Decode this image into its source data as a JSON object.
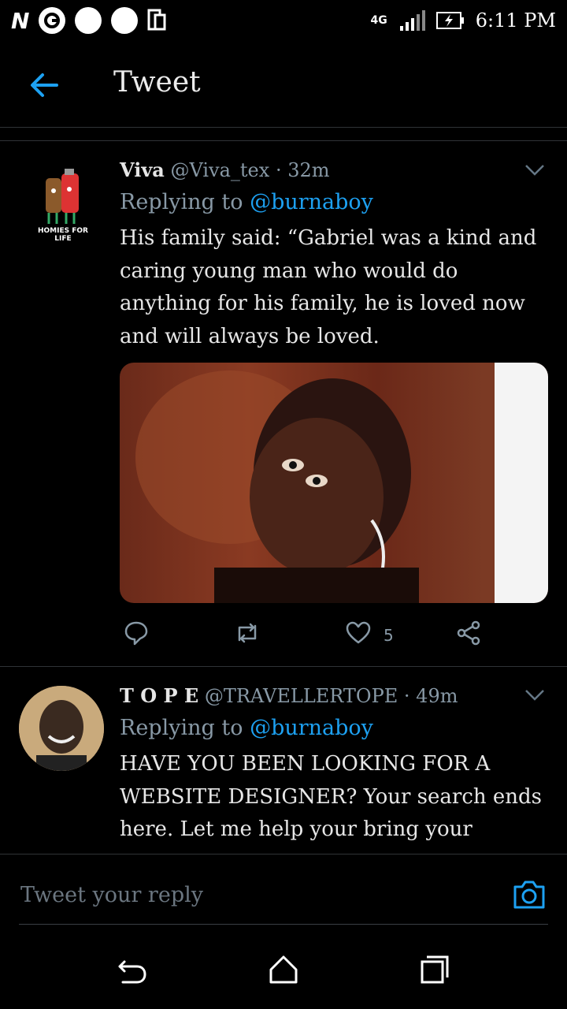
{
  "status_bar": {
    "network": "4G",
    "time": "6:11 PM"
  },
  "header": {
    "title": "Tweet"
  },
  "tweets": [
    {
      "name": "Viva",
      "handle": "@Viva_tex",
      "time": "· 32m",
      "replying_prefix": "Replying to",
      "replying_handle": "@burnaboy",
      "text": "His family said: “Gabriel was a kind and caring young man who would do anything for his family, he is loved now and will always be loved.",
      "likes": "5",
      "avatar_text": "HOMIES FOR LIFE"
    },
    {
      "name": "T O P E",
      "handle": "@TRAVELLERTOPE",
      "time": "· 49m",
      "replying_prefix": "Replying to",
      "replying_handle": "@burnaboy",
      "text": "HAVE YOU BEEN LOOKING FOR A WEBSITE DESIGNER? Your search ends here. Let me help your bring your"
    }
  ],
  "reply_bar": {
    "placeholder": "Tweet your reply"
  },
  "icons": {
    "back": "back-arrow-icon",
    "camera": "camera-icon"
  },
  "colors": {
    "accent": "#1da1f2",
    "muted": "#8899a6",
    "background": "#000000"
  }
}
